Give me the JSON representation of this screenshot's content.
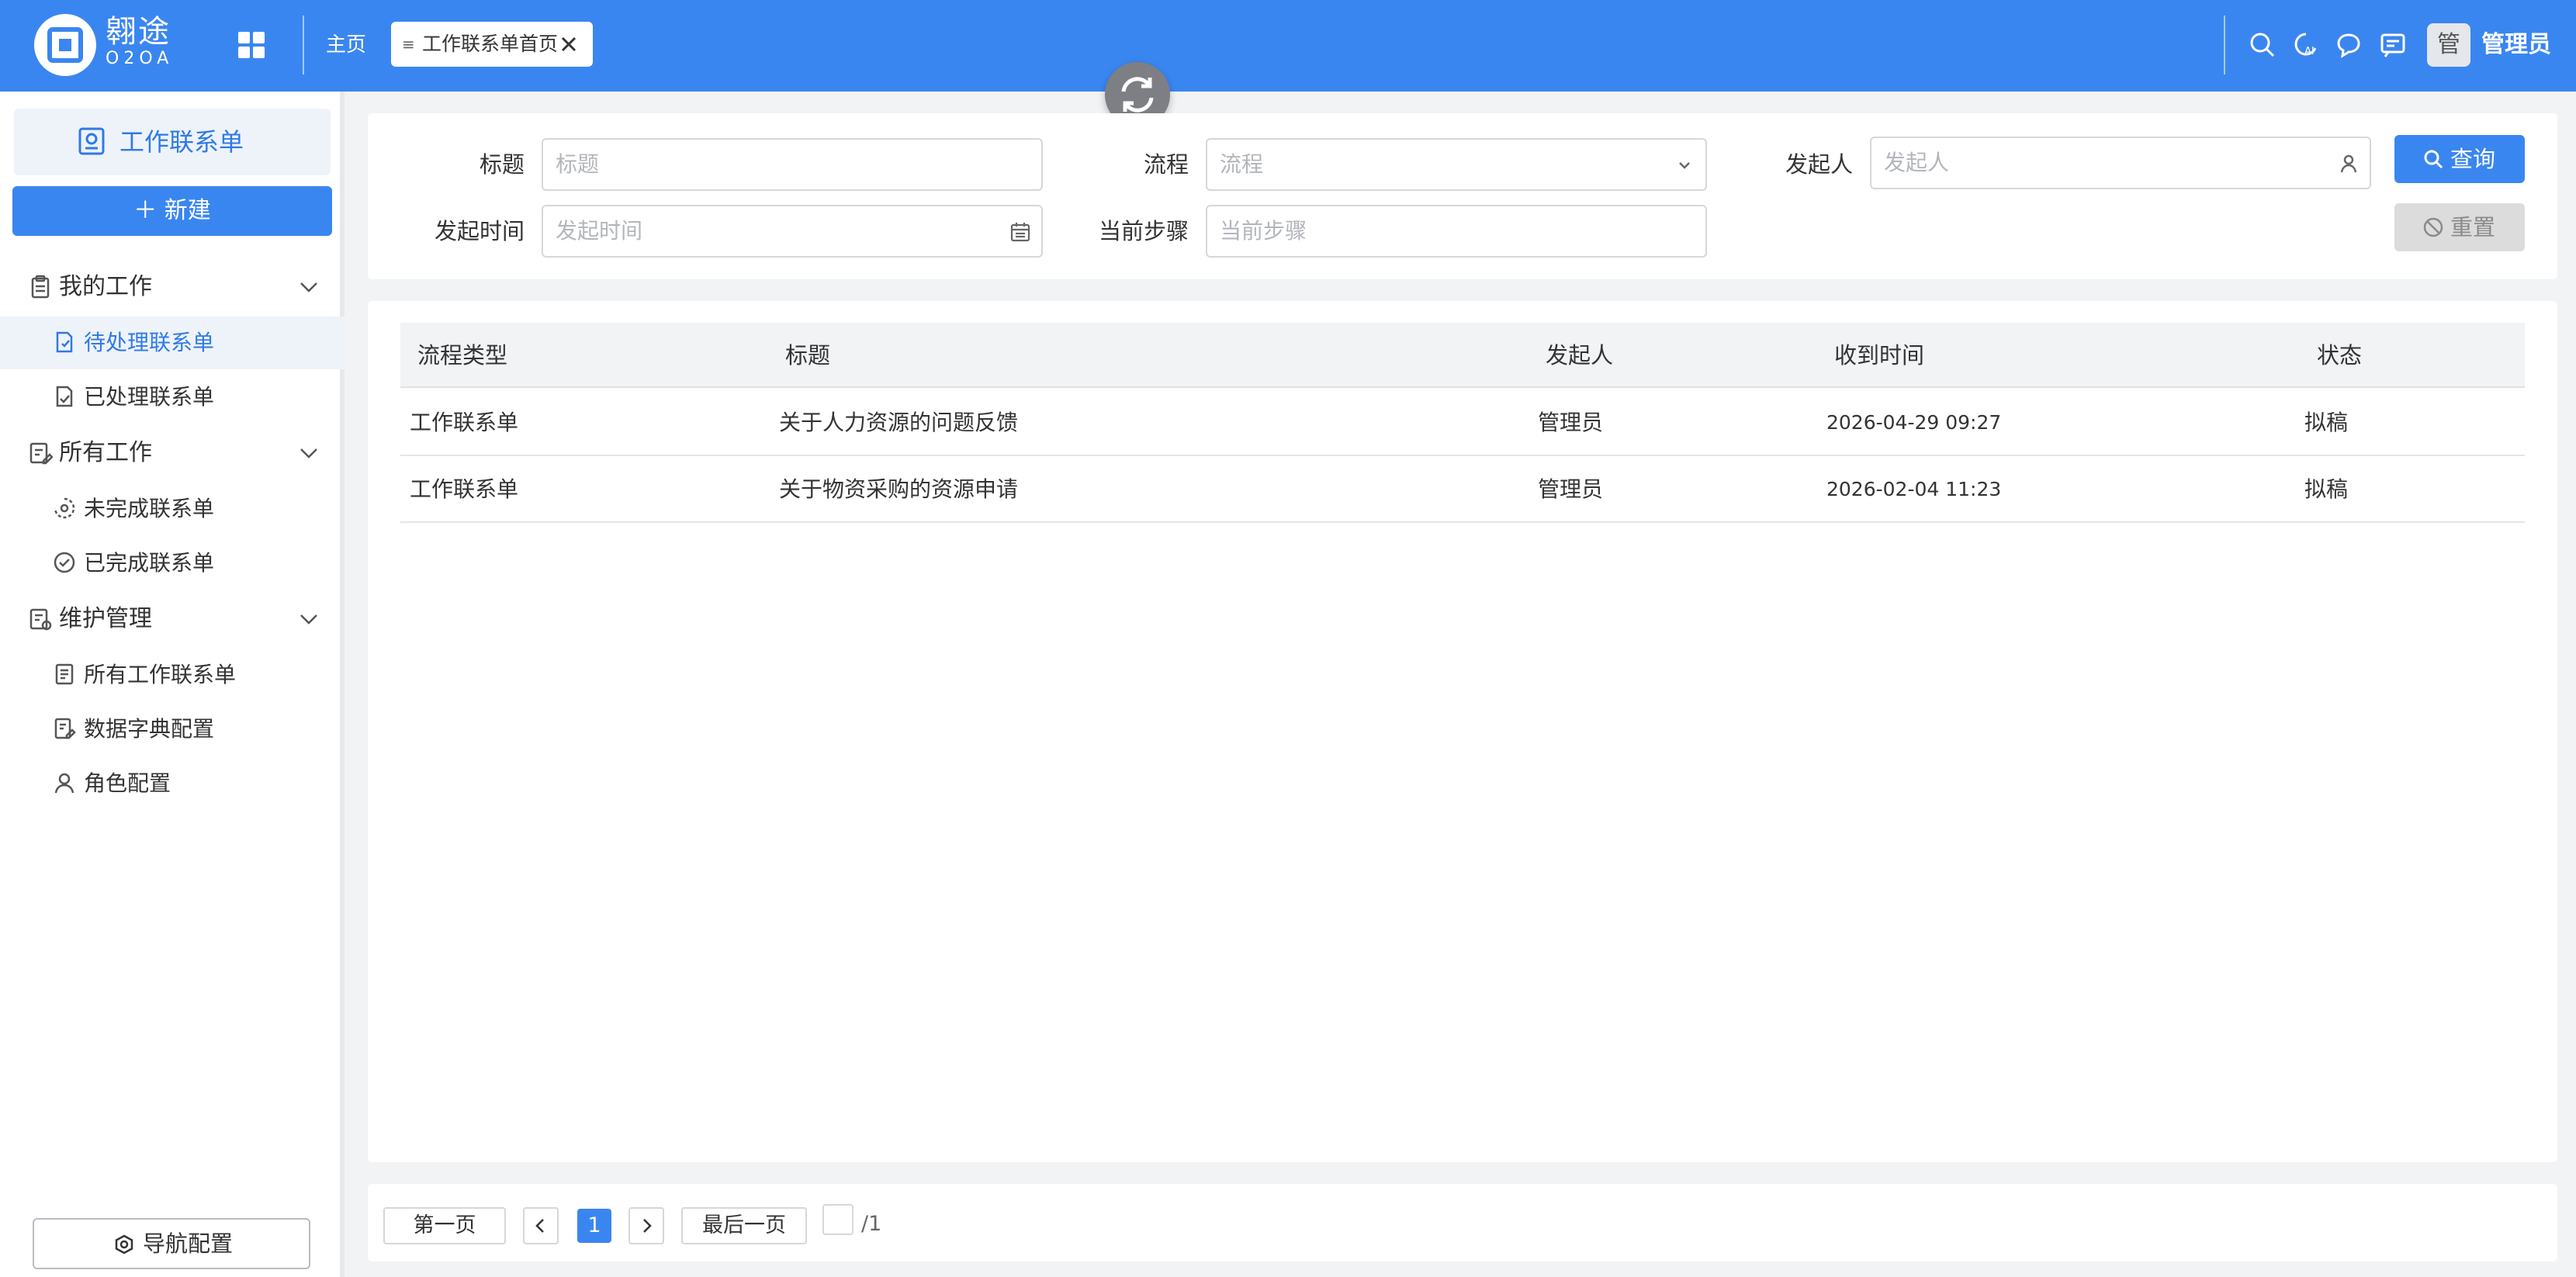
{
  "brand": {
    "name": "翱途",
    "sub": "O2OA",
    "accent": "#3a86f0"
  },
  "header": {
    "home_label": "主页",
    "tab_label": "工作联系单首页",
    "user_avatar_text": "管",
    "user_name": "管理员"
  },
  "sidebar": {
    "app_title": "工作联系单",
    "new_button": "新建",
    "groups": [
      {
        "label": "我的工作",
        "items": [
          {
            "label": "待处理联系单",
            "active": true
          },
          {
            "label": "已处理联系单",
            "active": false
          }
        ]
      },
      {
        "label": "所有工作",
        "items": [
          {
            "label": "未完成联系单",
            "active": false
          },
          {
            "label": "已完成联系单",
            "active": false
          }
        ]
      },
      {
        "label": "维护管理",
        "items": [
          {
            "label": "所有工作联系单",
            "active": false
          },
          {
            "label": "数据字典配置",
            "active": false
          },
          {
            "label": "角色配置",
            "active": false
          }
        ]
      }
    ],
    "nav_config_button": "导航配置"
  },
  "filter": {
    "title_label": "标题",
    "title_placeholder": "标题",
    "process_label": "流程",
    "process_placeholder": "流程",
    "creator_label": "发起人",
    "creator_placeholder": "发起人",
    "start_time_label": "发起时间",
    "start_time_placeholder": "发起时间",
    "step_label": "当前步骤",
    "step_placeholder": "当前步骤",
    "query_button": "查询",
    "reset_button": "重置"
  },
  "table": {
    "columns": [
      "流程类型",
      "标题",
      "发起人",
      "收到时间",
      "状态"
    ],
    "rows": [
      [
        "工作联系单",
        "关于人力资源的问题反馈",
        "管理员",
        "2026-04-29 09:27",
        "拟稿"
      ],
      [
        "工作联系单",
        "关于物资采购的资源申请",
        "管理员",
        "2026-02-04 11:23",
        "拟稿"
      ]
    ]
  },
  "pager": {
    "first": "第一页",
    "current": "1",
    "last": "最后一页",
    "total": "/1"
  }
}
